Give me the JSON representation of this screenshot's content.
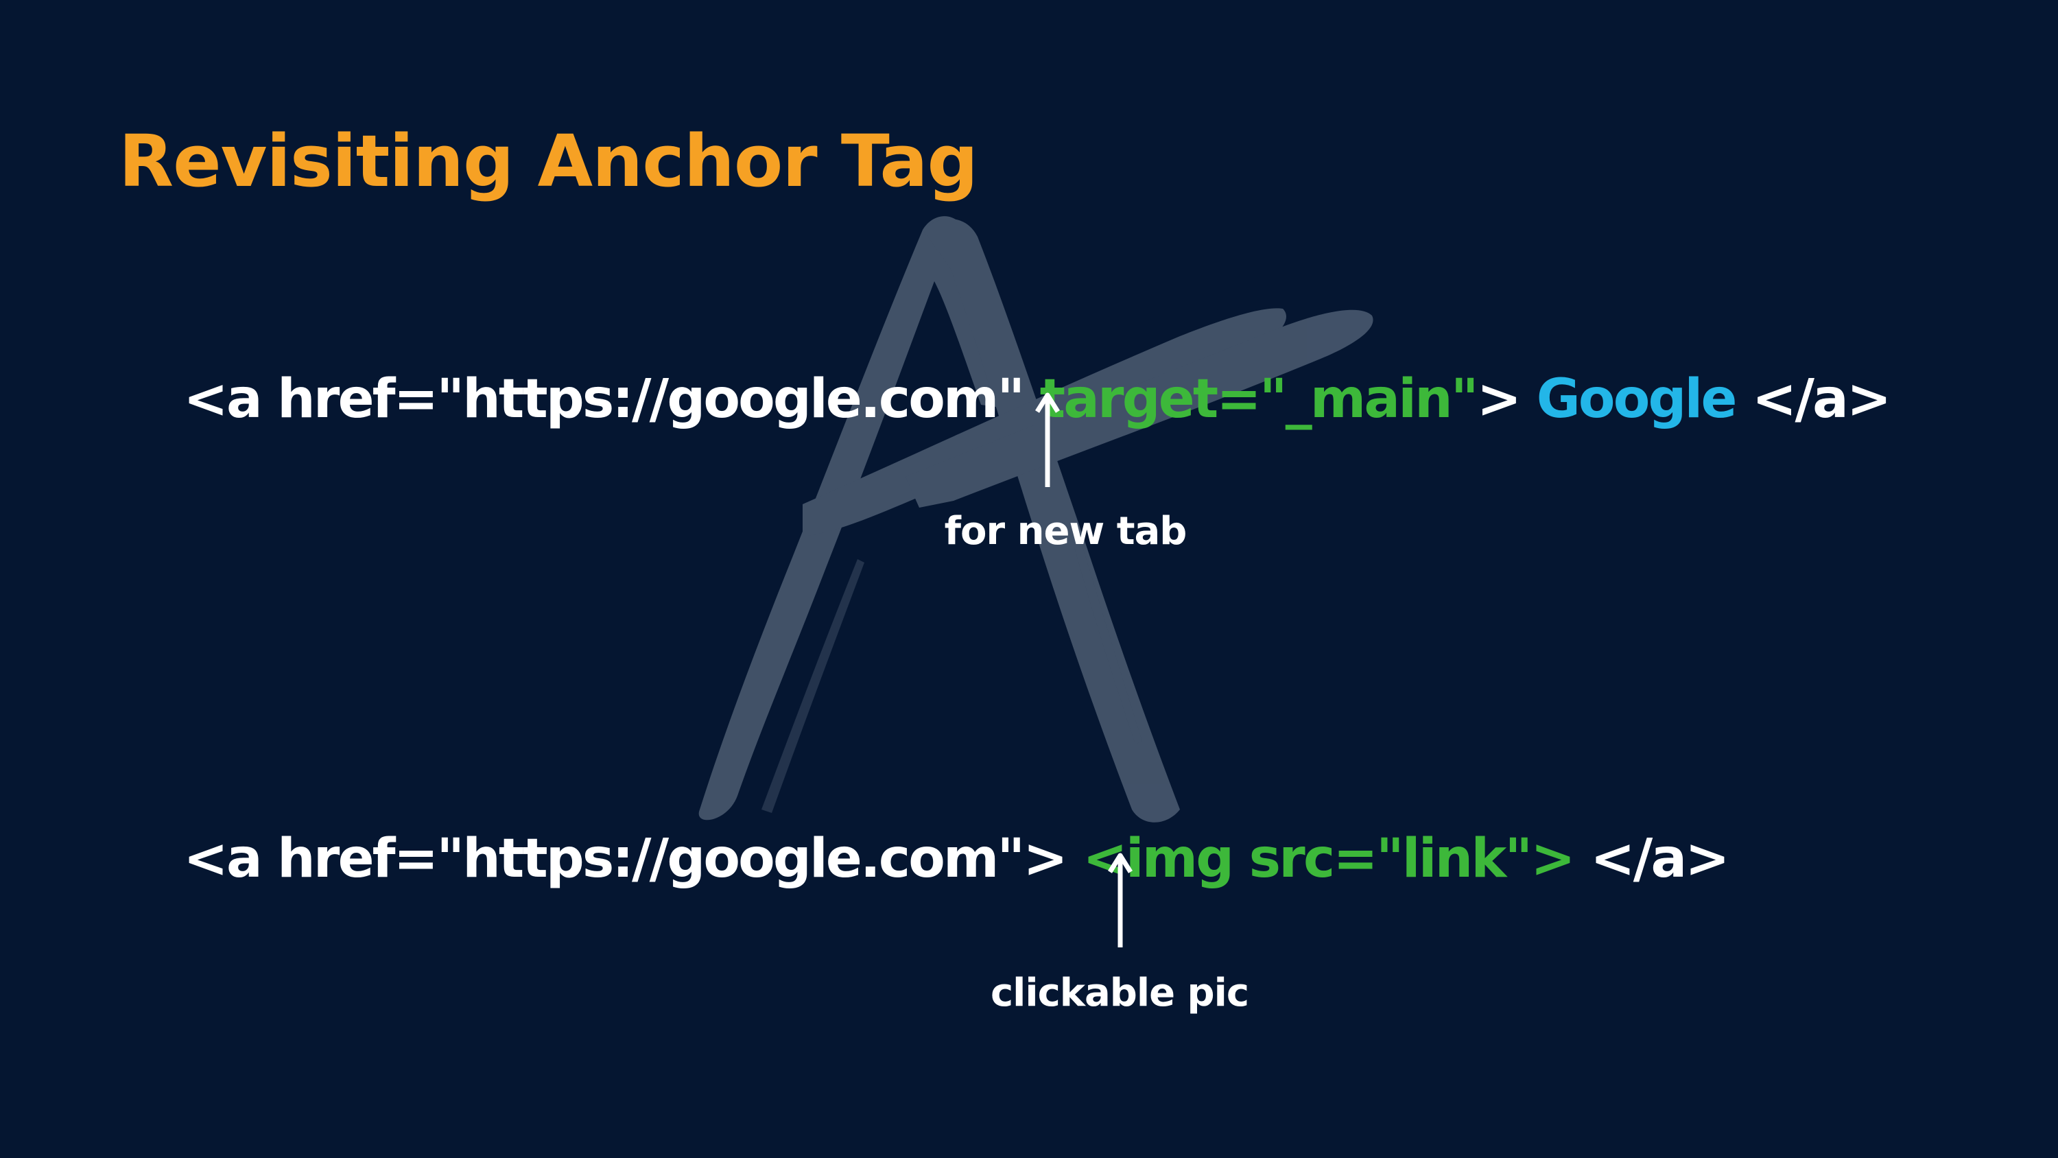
{
  "colors": {
    "background": "#051631",
    "title": "#f6a124",
    "code_default": "#ffffff",
    "attribute": "#3db83a",
    "link_text": "#23b6e8",
    "annotation": "#ffffff",
    "watermark": "#44546a"
  },
  "slide": {
    "title": "Revisiting Anchor Tag",
    "watermark_icon": "brush-letter-a-icon"
  },
  "example_one": {
    "open_tag_start": "<a href=\"https://google.com\" ",
    "target_attr": "target=\"_main\"",
    "tag_close": "> ",
    "link_text": "Google",
    "closing_tag": " </a>",
    "arrow_icon": "up-arrow-icon",
    "note": "for new tab"
  },
  "example_two": {
    "open_tag": "<a href=\"https://google.com\"> ",
    "img_tag": "<img src=\"link\">",
    "closing_tag": " </a>",
    "arrow_icon": "up-arrow-icon",
    "note": "clickable pic"
  }
}
